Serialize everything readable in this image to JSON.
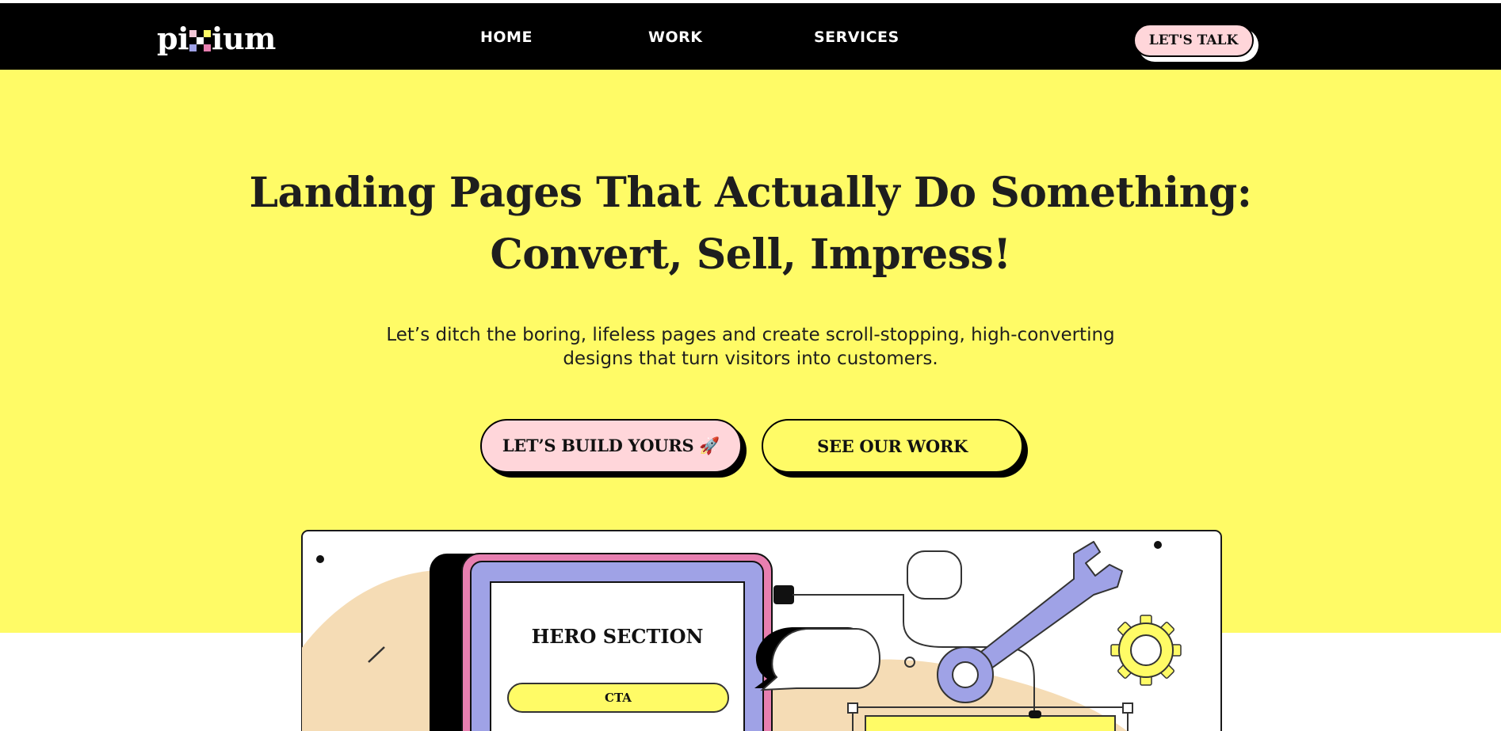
{
  "nav": {
    "logo_start": "pi",
    "logo_end": "ium",
    "links": [
      "HOME",
      "WORK",
      "SERVICES"
    ],
    "talk_label": "LET'S TALK"
  },
  "hero": {
    "headline_line1": "Landing Pages That Actually Do Something:",
    "headline_line2": "Convert, Sell, Impress!",
    "subline_line1": "Let’s ditch the boring, lifeless pages and create scroll-stopping, high-converting",
    "subline_line2": "designs that turn visitors into customers.",
    "cta_primary": "LET’S BUILD YOURS 🚀",
    "cta_secondary": "SEE OUR WORK"
  },
  "illustration": {
    "hero_section_label": "HERO SECTION",
    "cta_label": "CTA"
  },
  "colors": {
    "yellow": "#fffb66",
    "pink": "#ffd6da",
    "magenta": "#e77fb0",
    "lavender": "#9fa2e6",
    "peach": "#f5dcb5",
    "black": "#000000"
  }
}
